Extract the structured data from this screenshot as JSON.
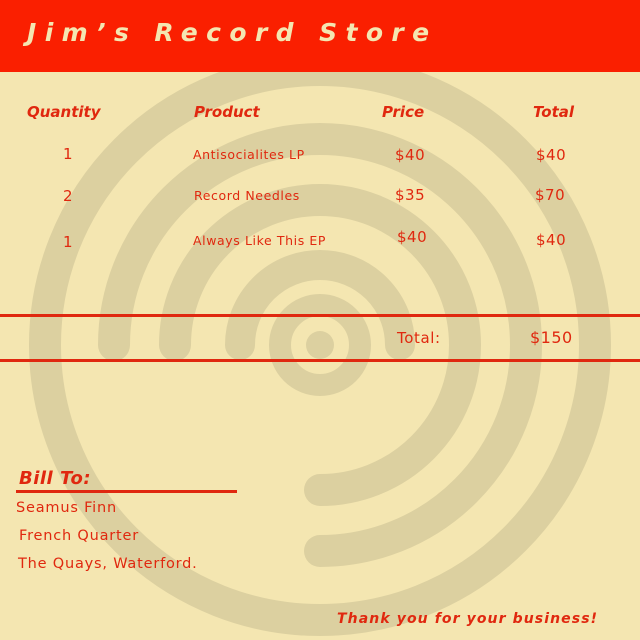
{
  "store": {
    "title": "Jim’s Record Store"
  },
  "colors": {
    "brand_red": "#fa1f00",
    "text_red": "#e0280f",
    "background": "#f4e6b1",
    "watermark": "#dcd0a0"
  },
  "watermark": {
    "icon": "vinyl-record-icon"
  },
  "table": {
    "headers": {
      "quantity": "Quantity",
      "product": "Product",
      "price": "Price",
      "total": "Total"
    },
    "rows": [
      {
        "quantity": "1",
        "product": "Antisocialites LP",
        "price": "$40",
        "total": "$40"
      },
      {
        "quantity": "2",
        "product": "Record Needles",
        "price": "$35",
        "total": "$70"
      },
      {
        "quantity": "1",
        "product": "Always Like This EP",
        "price": "$40",
        "total": "$40"
      }
    ],
    "grand_total_label": "Total:",
    "grand_total_value": "$150"
  },
  "bill_to": {
    "heading": "Bill To:",
    "lines": [
      "Seamus Finn",
      "French Quarter",
      "The Quays, Waterford."
    ]
  },
  "footer": {
    "thanks": "Thank you for your business!"
  }
}
